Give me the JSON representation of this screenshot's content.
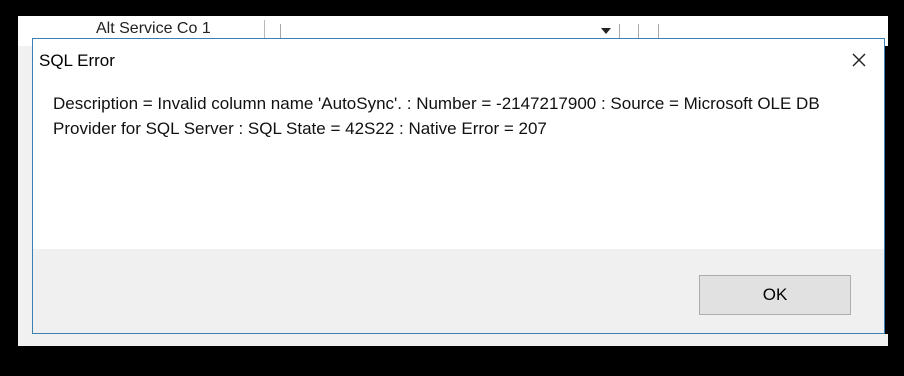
{
  "background_app": {
    "cell_text": "Alt Service Co 1"
  },
  "dialog": {
    "title": "SQL Error",
    "message": "Description = Invalid column name 'AutoSync'. : Number = -2147217900 : Source = Microsoft OLE DB Provider for SQL Server : SQL State = 42S22 : Native Error = 207",
    "ok_label": "OK",
    "close_icon": "close-icon"
  },
  "colors": {
    "dialog_border": "#3c7fb1",
    "footer_bg": "#f0f0f0",
    "button_bg": "#e1e1e1"
  }
}
